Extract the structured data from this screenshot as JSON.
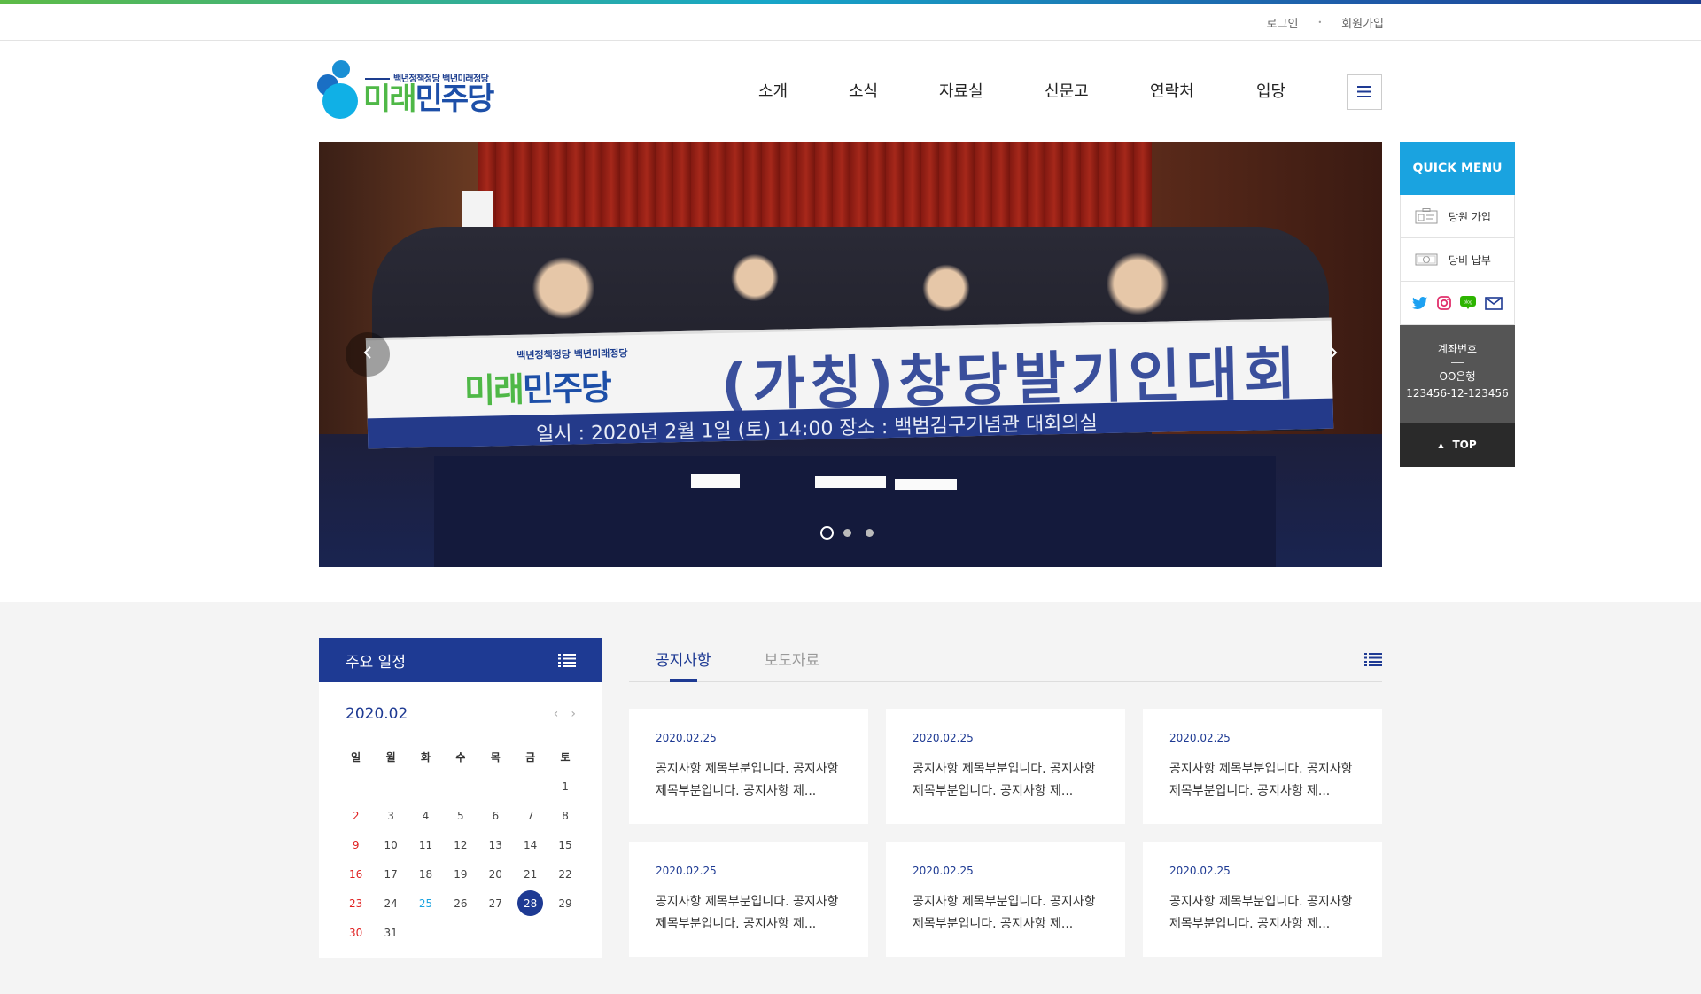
{
  "util": {
    "login": "로그인",
    "signup": "회원가입"
  },
  "logo": {
    "slogan": "백년정책정당 백년미래정당",
    "name_part1": "미래",
    "name_part2": "민주당"
  },
  "nav": {
    "items": [
      "소개",
      "소식",
      "자료실",
      "신문고",
      "연락처",
      "입당"
    ],
    "menu_icon": "hamburger-icon"
  },
  "hero": {
    "banner_slogan": "백년정책정당 백년미래정당",
    "banner_logo_part1": "미래",
    "banner_logo_part2": "민주당",
    "banner_title": "(가칭)창당발기인대회",
    "banner_info": "일시 : 2020년 2월 1일 (토) 14:00    장소 : 백범김구기념관 대회의실",
    "slide_count": 3,
    "active_slide": 1
  },
  "quick_menu": {
    "title": "QUICK MENU",
    "items": [
      {
        "label": "당원 가입",
        "icon": "member-card-icon"
      },
      {
        "label": "당비 납부",
        "icon": "money-icon"
      }
    ],
    "sns": [
      "twitter-icon",
      "instagram-icon",
      "blog-icon",
      "mail-icon"
    ],
    "account_label": "계좌번호",
    "bank": "OO은행",
    "account_number": "123456-12-123456",
    "top_label": "TOP"
  },
  "calendar": {
    "title": "주요 일정",
    "month": "2020.02",
    "weekdays": [
      "일",
      "월",
      "화",
      "수",
      "목",
      "금",
      "토"
    ],
    "weeks": [
      [
        "",
        "",
        "",
        "",
        "",
        "",
        "1"
      ],
      [
        "2",
        "3",
        "4",
        "5",
        "6",
        "7",
        "8"
      ],
      [
        "9",
        "10",
        "11",
        "12",
        "13",
        "14",
        "15"
      ],
      [
        "16",
        "17",
        "18",
        "19",
        "20",
        "21",
        "22"
      ],
      [
        "23",
        "24",
        "25",
        "26",
        "27",
        "28",
        "29"
      ],
      [
        "30",
        "31",
        "",
        "",
        "",
        "",
        ""
      ]
    ],
    "today": "25",
    "selected": "28"
  },
  "board": {
    "tabs": [
      {
        "label": "공지사항",
        "active": true
      },
      {
        "label": "보도자료",
        "active": false
      }
    ],
    "cards": [
      {
        "date": "2020.02.25",
        "text": "공지사항 제목부분입니다. 공지사항 제목부분입니다. 공지사항 제..."
      },
      {
        "date": "2020.02.25",
        "text": "공지사항 제목부분입니다. 공지사항 제목부분입니다. 공지사항 제..."
      },
      {
        "date": "2020.02.25",
        "text": "공지사항 제목부분입니다. 공지사항 제목부분입니다. 공지사항 제..."
      },
      {
        "date": "2020.02.25",
        "text": "공지사항 제목부분입니다. 공지사항 제목부분입니다. 공지사항 제..."
      },
      {
        "date": "2020.02.25",
        "text": "공지사항 제목부분입니다. 공지사항 제목부분입니다. 공지사항 제..."
      },
      {
        "date": "2020.02.25",
        "text": "공지사항 제목부분입니다. 공지사항 제목부분입니다. 공지사항 제..."
      }
    ]
  },
  "colors": {
    "primary": "#1e3a93",
    "accent": "#1aa3e0",
    "sunday": "#e02020",
    "logo_green": "#4fb847",
    "logo_blue": "#1d4fa8"
  }
}
